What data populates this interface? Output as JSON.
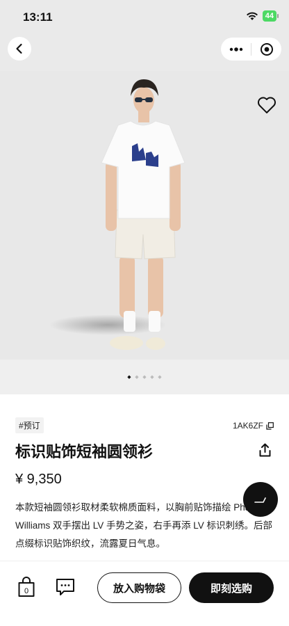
{
  "status_bar": {
    "time": "13:11",
    "battery": "44"
  },
  "product": {
    "tag": "#预订",
    "sku": "1AK6ZF",
    "title": "标识贴饰短袖圆领衫",
    "price": "¥ 9,350",
    "description": "本款短袖圆领衫取材柔软棉质面料，以胸前贴饰描绘 Pharrell Williams 双手摆出 LV 手势之姿，右手再添 LV 标识刺绣。后部点缀标识贴饰织纹，流露夏日气息。"
  },
  "carousel": {
    "count": 5,
    "active": 0
  },
  "actions": {
    "add_to_bag": "放入购物袋",
    "buy_now": "即刻选购",
    "bag_count": "0"
  },
  "icons": [
    "back-icon",
    "more-icon",
    "target-icon",
    "heart-icon",
    "copy-icon",
    "share-icon",
    "bag-icon",
    "message-icon",
    "chat-icon"
  ]
}
